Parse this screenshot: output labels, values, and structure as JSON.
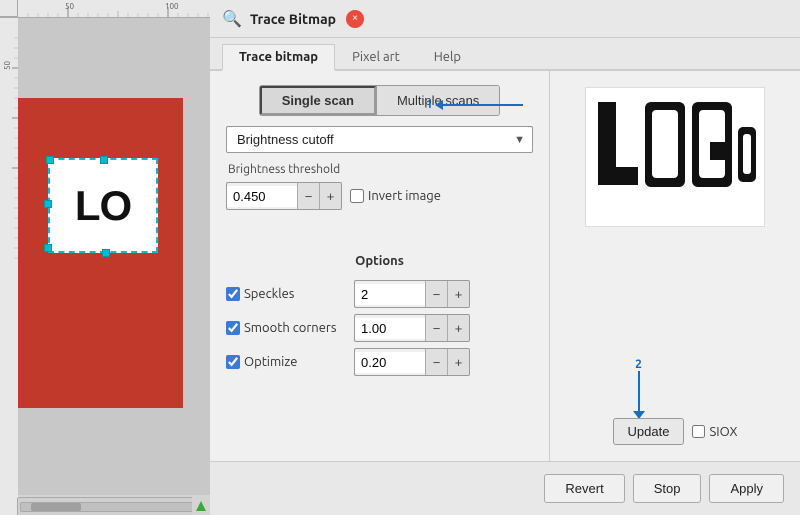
{
  "window": {
    "title": "Trace Bitmap",
    "close_label": "×"
  },
  "tabs": {
    "items": [
      {
        "label": "Trace bitmap",
        "active": true
      },
      {
        "label": "Pixel art",
        "active": false
      },
      {
        "label": "Help",
        "active": false
      }
    ]
  },
  "scan_buttons": {
    "single": "Single scan",
    "multiple": "Multiple scans"
  },
  "mode_dropdown": {
    "value": "Brightness cutoff",
    "annotation_num": "1"
  },
  "threshold": {
    "label": "Brightness threshold",
    "value": "0.450",
    "invert_label": "Invert image"
  },
  "options": {
    "title": "Options",
    "speckles": {
      "label": "Speckles",
      "checked": true,
      "value": "2"
    },
    "smooth_corners": {
      "label": "Smooth corners",
      "checked": true,
      "value": "1.00"
    },
    "optimize": {
      "label": "Optimize",
      "checked": true,
      "value": "0.20"
    }
  },
  "preview": {
    "logo_text": "LOGo"
  },
  "update_section": {
    "update_label": "Update",
    "siox_label": "SIOX",
    "annotation_num": "2"
  },
  "footer": {
    "revert_label": "Revert",
    "stop_label": "Stop",
    "apply_label": "Apply"
  },
  "icons": {
    "trace_bitmap": "🔍",
    "dropdown_arrow": "▼",
    "minus": "−",
    "plus": "+"
  }
}
